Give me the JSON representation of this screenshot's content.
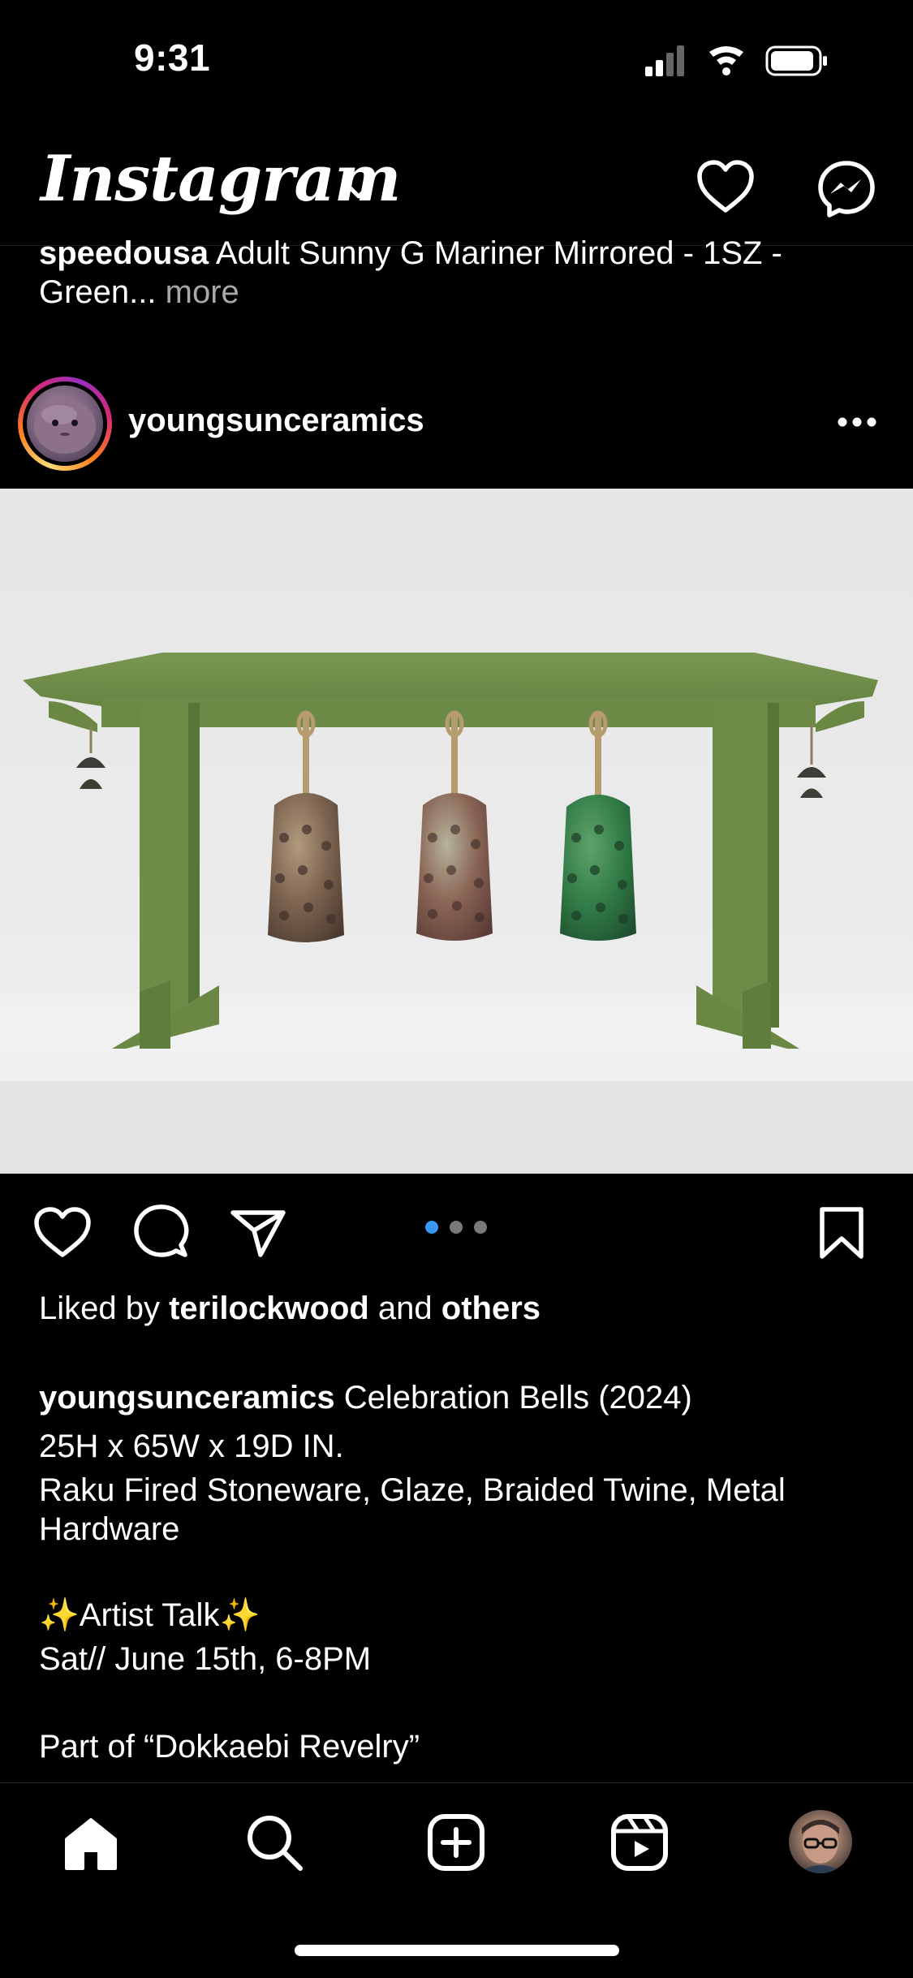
{
  "status_bar": {
    "time": "9:31"
  },
  "header": {
    "logo": "Instagram",
    "icons": [
      "chevron-down-icon",
      "heart-icon",
      "messenger-icon"
    ]
  },
  "previous_post": {
    "username": "speedousa",
    "caption_text": " Adult Sunny G Mariner Mirrored - 1SZ - Green...",
    "more_label": " more"
  },
  "post": {
    "username": "youngsunceramics",
    "carousel": {
      "count": 3,
      "active_index": 0,
      "active_color": "#3897f0"
    },
    "liked_by_prefix": "Liked by ",
    "liked_by_user": "terilockwood",
    "liked_by_middle": " and ",
    "liked_by_others": "others",
    "caption_username": "youngsunceramics",
    "caption_title": " Celebration Bells (2024)",
    "caption_dimensions": "25H x 65W x 19D IN.",
    "caption_materials": "Raku Fired Stoneware, Glaze, Braided Twine, Metal Hardware",
    "caption_event": "✨Artist Talk✨",
    "caption_date": "Sat// June 15th, 6-8PM",
    "caption_part_of": "Part of “Dokkaebi Revelry”"
  },
  "tab_bar": {
    "items": [
      "home-icon",
      "search-icon",
      "create-icon",
      "reels-icon",
      "profile-avatar"
    ]
  }
}
